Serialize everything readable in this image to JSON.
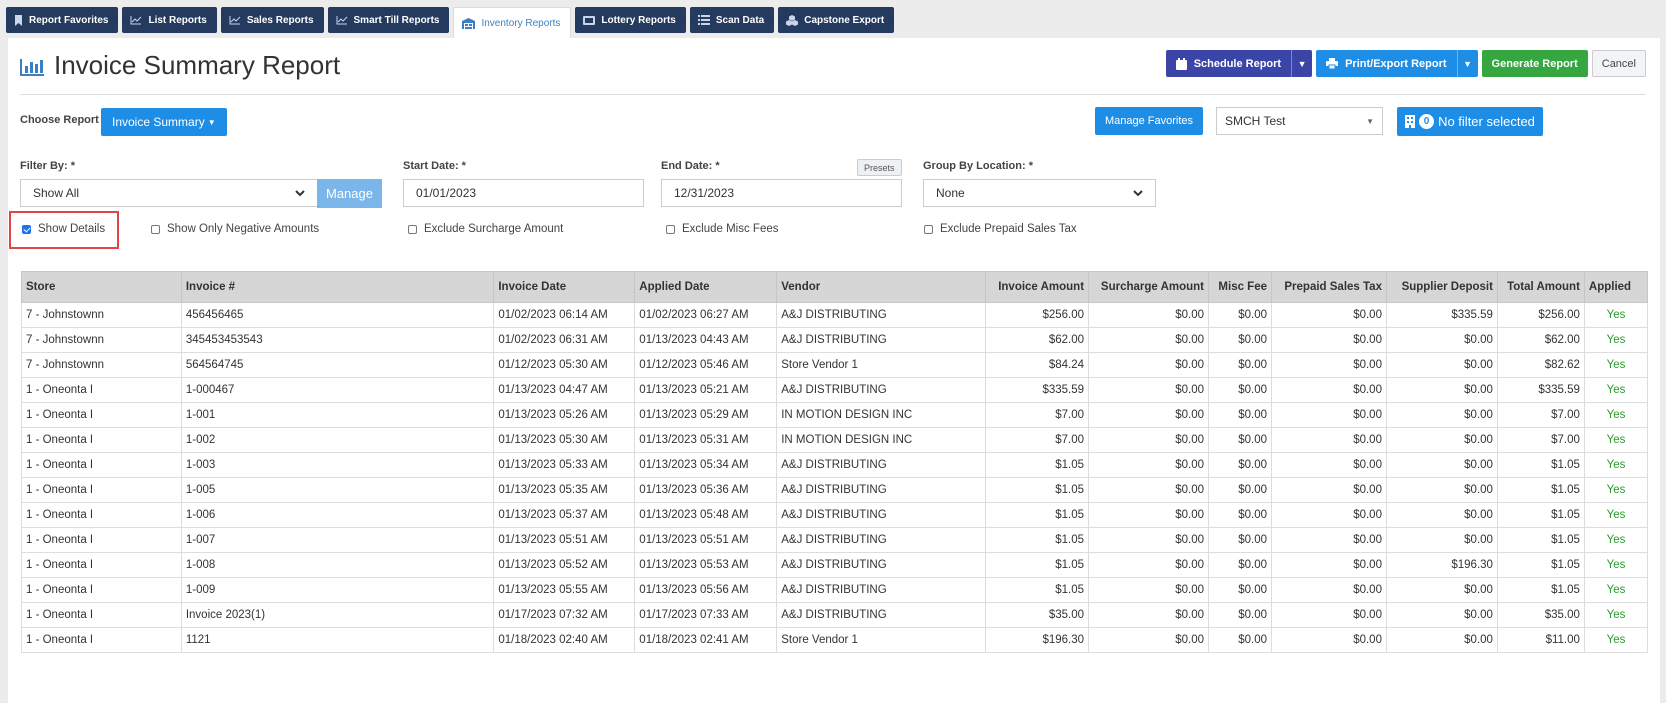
{
  "tabs": [
    {
      "label": "Report Favorites",
      "icon": "bookmark-icon"
    },
    {
      "label": "List Reports",
      "icon": "line-chart-icon"
    },
    {
      "label": "Sales Reports",
      "icon": "line-chart-icon"
    },
    {
      "label": "Smart Till Reports",
      "icon": "line-chart-icon"
    },
    {
      "label": "Inventory Reports",
      "icon": "warehouse-icon"
    },
    {
      "label": "Lottery Reports",
      "icon": "ticket-icon"
    },
    {
      "label": "Scan Data",
      "icon": "list-icon"
    },
    {
      "label": "Capstone Export",
      "icon": "cubes-icon"
    }
  ],
  "page": {
    "title": "Invoice Summary Report"
  },
  "toolbar": {
    "schedule_label": "Schedule Report",
    "print_label": "Print/Export Report",
    "generate_label": "Generate Report",
    "cancel_label": "Cancel"
  },
  "choose": {
    "label": "Choose Report",
    "selected": "Invoice Summary",
    "manage_favorites": "Manage Favorites",
    "store": "SMCH Test",
    "filter_count": "0",
    "filter_label": "No filter selected"
  },
  "filters": {
    "filter_by_label": "Filter By: *",
    "filter_by_value": "Show All",
    "manage_label": "Manage",
    "start_label": "Start Date: *",
    "start_value": "01/01/2023",
    "end_label": "End Date: *",
    "end_value": "12/31/2023",
    "presets_label": "Presets",
    "group_label": "Group By Location: *",
    "group_value": "None"
  },
  "options": [
    {
      "label": "Show Details",
      "checked": true
    },
    {
      "label": "Show Only Negative Amounts",
      "checked": false
    },
    {
      "label": "Exclude Surcharge Amount",
      "checked": false
    },
    {
      "label": "Exclude Misc Fees",
      "checked": false
    },
    {
      "label": "Exclude Prepaid Sales Tax",
      "checked": false
    }
  ],
  "table": {
    "columns": [
      "Store",
      "Invoice #",
      "Invoice Date",
      "Applied Date",
      "Vendor",
      "Invoice Amount",
      "Surcharge Amount",
      "Misc Fee",
      "Prepaid Sales Tax",
      "Supplier Deposit",
      "Total Amount",
      "Applied"
    ],
    "rows": [
      [
        "7 - Johnstownn",
        "456456465",
        "01/02/2023 06:14 AM",
        "01/02/2023 06:27 AM",
        "A&J DISTRIBUTING",
        "$256.00",
        "$0.00",
        "$0.00",
        "$0.00",
        "$335.59",
        "$256.00",
        "Yes"
      ],
      [
        "7 - Johnstownn",
        "345453453543",
        "01/02/2023 06:31 AM",
        "01/13/2023 04:43 AM",
        "A&J DISTRIBUTING",
        "$62.00",
        "$0.00",
        "$0.00",
        "$0.00",
        "$0.00",
        "$62.00",
        "Yes"
      ],
      [
        "7 - Johnstownn",
        "564564745",
        "01/12/2023 05:30 AM",
        "01/12/2023 05:46 AM",
        "Store Vendor 1",
        "$84.24",
        "$0.00",
        "$0.00",
        "$0.00",
        "$0.00",
        "$82.62",
        "Yes"
      ],
      [
        "1 - Oneonta I",
        "1-000467",
        "01/13/2023 04:47 AM",
        "01/13/2023 05:21 AM",
        "A&J DISTRIBUTING",
        "$335.59",
        "$0.00",
        "$0.00",
        "$0.00",
        "$0.00",
        "$335.59",
        "Yes"
      ],
      [
        "1 - Oneonta I",
        "1-001",
        "01/13/2023 05:26 AM",
        "01/13/2023 05:29 AM",
        "IN MOTION DESIGN INC",
        "$7.00",
        "$0.00",
        "$0.00",
        "$0.00",
        "$0.00",
        "$7.00",
        "Yes"
      ],
      [
        "1 - Oneonta I",
        "1-002",
        "01/13/2023 05:30 AM",
        "01/13/2023 05:31 AM",
        "IN MOTION DESIGN INC",
        "$7.00",
        "$0.00",
        "$0.00",
        "$0.00",
        "$0.00",
        "$7.00",
        "Yes"
      ],
      [
        "1 - Oneonta I",
        "1-003",
        "01/13/2023 05:33 AM",
        "01/13/2023 05:34 AM",
        "A&J DISTRIBUTING",
        "$1.05",
        "$0.00",
        "$0.00",
        "$0.00",
        "$0.00",
        "$1.05",
        "Yes"
      ],
      [
        "1 - Oneonta I",
        "1-005",
        "01/13/2023 05:35 AM",
        "01/13/2023 05:36 AM",
        "A&J DISTRIBUTING",
        "$1.05",
        "$0.00",
        "$0.00",
        "$0.00",
        "$0.00",
        "$1.05",
        "Yes"
      ],
      [
        "1 - Oneonta I",
        "1-006",
        "01/13/2023 05:37 AM",
        "01/13/2023 05:48 AM",
        "A&J DISTRIBUTING",
        "$1.05",
        "$0.00",
        "$0.00",
        "$0.00",
        "$0.00",
        "$1.05",
        "Yes"
      ],
      [
        "1 - Oneonta I",
        "1-007",
        "01/13/2023 05:51 AM",
        "01/13/2023 05:51 AM",
        "A&J DISTRIBUTING",
        "$1.05",
        "$0.00",
        "$0.00",
        "$0.00",
        "$0.00",
        "$1.05",
        "Yes"
      ],
      [
        "1 - Oneonta I",
        "1-008",
        "01/13/2023 05:52 AM",
        "01/13/2023 05:53 AM",
        "A&J DISTRIBUTING",
        "$1.05",
        "$0.00",
        "$0.00",
        "$0.00",
        "$196.30",
        "$1.05",
        "Yes"
      ],
      [
        "1 - Oneonta I",
        "1-009",
        "01/13/2023 05:55 AM",
        "01/13/2023 05:56 AM",
        "A&J DISTRIBUTING",
        "$1.05",
        "$0.00",
        "$0.00",
        "$0.00",
        "$0.00",
        "$1.05",
        "Yes"
      ],
      [
        "1 - Oneonta I",
        "Invoice 2023(1)",
        "01/17/2023 07:32 AM",
        "01/17/2023 07:33 AM",
        "A&J DISTRIBUTING",
        "$35.00",
        "$0.00",
        "$0.00",
        "$0.00",
        "$0.00",
        "$35.00",
        "Yes"
      ],
      [
        "1 - Oneonta I",
        "1121",
        "01/18/2023 02:40 AM",
        "01/18/2023 02:41 AM",
        "Store Vendor 1",
        "$196.30",
        "$0.00",
        "$0.00",
        "$0.00",
        "$0.00",
        "$11.00",
        "Yes"
      ]
    ]
  }
}
